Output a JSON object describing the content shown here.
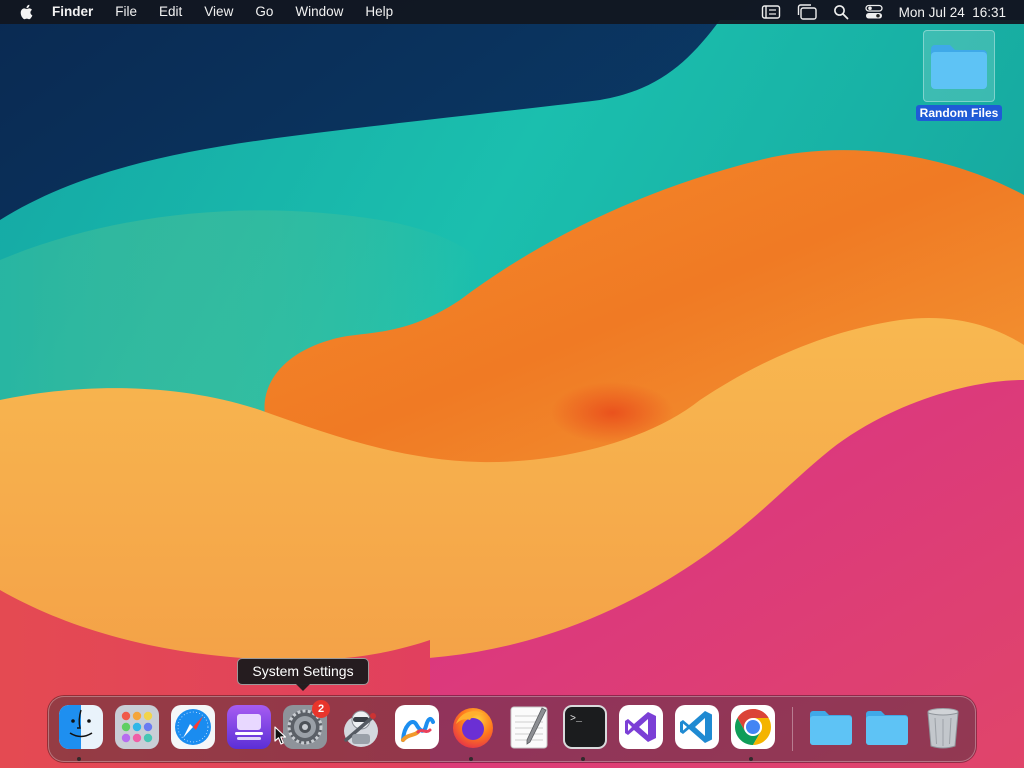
{
  "menubar": {
    "app_name": "Finder",
    "menus": [
      "File",
      "Edit",
      "View",
      "Go",
      "Window",
      "Help"
    ],
    "status_icons": [
      "list-icon",
      "stage-manager-icon",
      "spotlight-search-icon",
      "control-center-icon"
    ],
    "clock": "Mon Jul 24  16:31"
  },
  "desktop": {
    "items": [
      {
        "label": "Random Files",
        "icon": "folder-icon",
        "selected": true
      }
    ]
  },
  "tooltip": {
    "text": "System Settings"
  },
  "dock": {
    "apps": [
      {
        "name": "Finder",
        "icon": "finder-icon",
        "running": true
      },
      {
        "name": "Launchpad",
        "icon": "launchpad-icon",
        "running": false
      },
      {
        "name": "Safari",
        "icon": "safari-icon",
        "running": false
      },
      {
        "name": "Apple Configurator",
        "icon": "configurator-icon",
        "running": false
      },
      {
        "name": "System Settings",
        "icon": "system-settings-icon",
        "running": false,
        "badge": "2"
      },
      {
        "name": "Automator",
        "icon": "automator-icon",
        "running": false
      },
      {
        "name": "Freeform",
        "icon": "freeform-icon",
        "running": false
      },
      {
        "name": "Firefox",
        "icon": "firefox-icon",
        "running": true
      },
      {
        "name": "TextEdit",
        "icon": "textedit-icon",
        "running": false
      },
      {
        "name": "Terminal",
        "icon": "terminal-icon",
        "running": true
      },
      {
        "name": "Visual Studio",
        "icon": "visual-studio-icon",
        "running": false
      },
      {
        "name": "Visual Studio Code",
        "icon": "vscode-icon",
        "running": false
      },
      {
        "name": "Google Chrome",
        "icon": "chrome-icon",
        "running": true
      }
    ],
    "stacks": [
      {
        "name": "Applications",
        "icon": "folder-icon"
      },
      {
        "name": "Downloads",
        "icon": "folder-icon"
      },
      {
        "name": "Trash",
        "icon": "trash-icon"
      }
    ]
  },
  "colors": {
    "menubar_bg": "#12161e",
    "selection_blue": "#1f5bd6",
    "badge_red": "#e8352b",
    "folder_blue": "#5ec3f5"
  }
}
